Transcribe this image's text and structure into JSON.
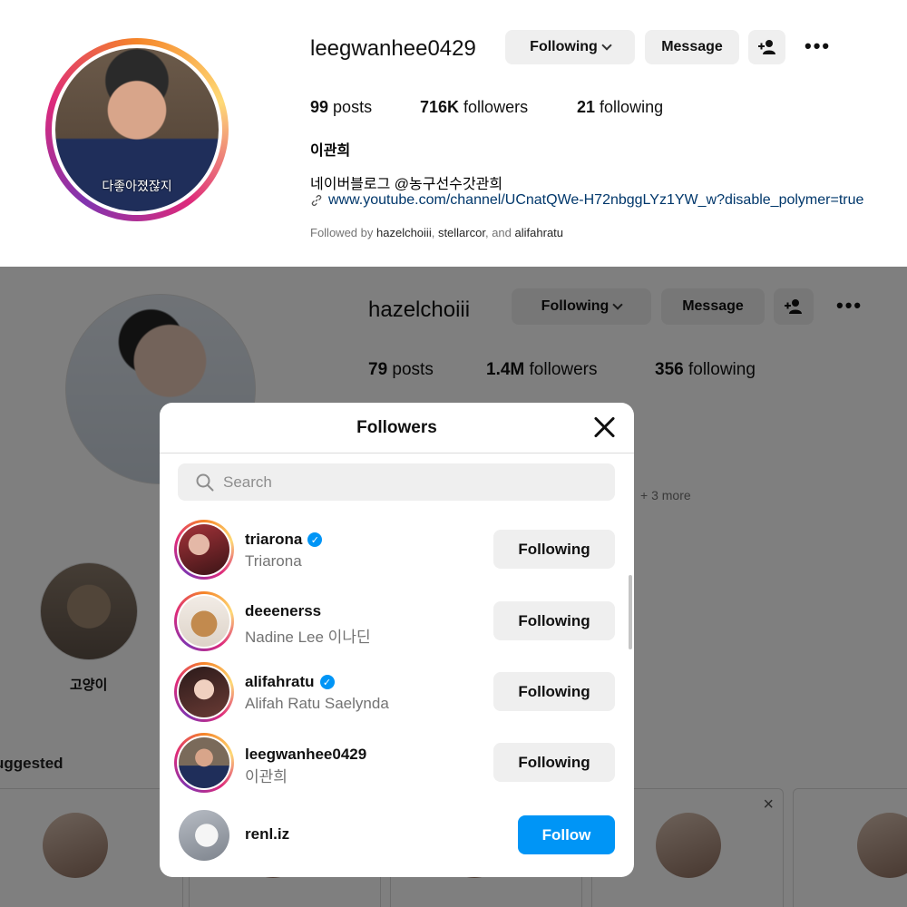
{
  "top_profile": {
    "username": "leegwanhee0429",
    "following_label": "Following",
    "message_label": "Message",
    "posts_count": "99",
    "posts_label": "posts",
    "followers_count": "716K",
    "followers_label": "followers",
    "following_count": "21",
    "following_stat_label": "following",
    "full_name": "이관희",
    "avatar_caption": "다좋아졌잖지",
    "bio": "네이버블로그 @농구선수갓관희",
    "link": "www.youtube.com/channel/UCnatQWe-H72nbggLYz1YW_w?disable_polymer=true",
    "followed_by_prefix": "Followed by",
    "followed_by_1": "hazelchoiii",
    "followed_by_2": "stellarcor",
    "followed_by_and": "and",
    "followed_by_3": "alifahratu"
  },
  "bg_profile": {
    "username": "hazelchoiii",
    "following_label": "Following",
    "message_label": "Message",
    "posts_count": "79",
    "posts_label": "posts",
    "followers_count": "1.4M",
    "followers_label": "followers",
    "following_count": "356",
    "following_stat_label": "following",
    "more_text": "+ 3 more",
    "highlight_label": "고양이",
    "suggested_label": "uggested"
  },
  "modal": {
    "title": "Followers",
    "search_placeholder": "Search",
    "rows": [
      {
        "handle": "triarona",
        "name": "Triarona",
        "verified": true,
        "button": "Following"
      },
      {
        "handle": "deeenerss",
        "name": "Nadine Lee 이나딘",
        "verified": false,
        "button": "Following"
      },
      {
        "handle": "alifahratu",
        "name": "Alifah Ratu Saelynda",
        "verified": true,
        "button": "Following"
      },
      {
        "handle": "leegwanhee0429",
        "name": "이관희",
        "verified": false,
        "button": "Following"
      },
      {
        "handle": "renl.iz",
        "name": "",
        "verified": false,
        "button": "Follow"
      }
    ]
  },
  "colors": {
    "accent_blue": "#0095f6",
    "button_gray": "#efefef",
    "link_blue": "#00376b",
    "muted_text": "#737373"
  },
  "icons": {
    "more": "ellipsis-icon",
    "add_person": "add-person-icon",
    "link": "link-icon",
    "search": "search-icon",
    "close": "close-icon",
    "verified": "verified-badge-icon"
  }
}
